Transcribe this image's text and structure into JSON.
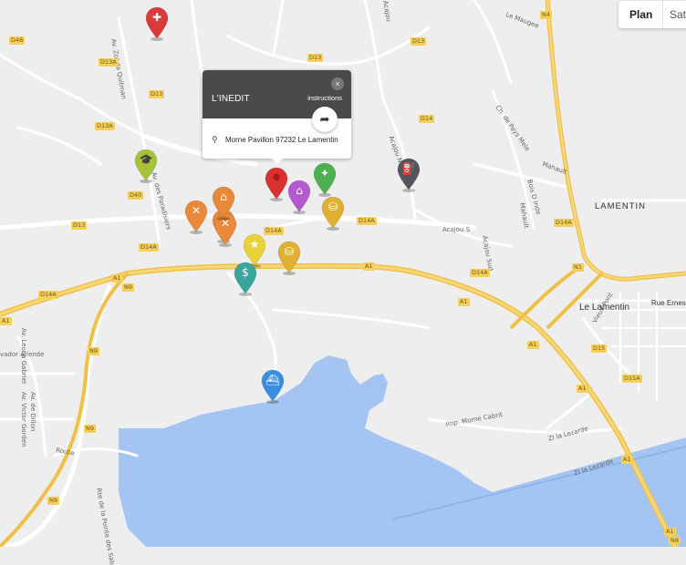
{
  "map_toggle": {
    "plan": "Plan",
    "satellite": "Sat"
  },
  "popup": {
    "title": "L'INEDIT",
    "instructions": "instructions",
    "close": "×",
    "address": "Morne Pavillon 97232 Le Lamentin",
    "directions_glyph": "➦",
    "location_glyph": "⚲"
  },
  "places": {
    "lamentin_region": "LAMENTIN",
    "le_lamentin": "Le Lamentin",
    "rue_ernest": "Rue Ernest"
  },
  "shields": {
    "d48": "D48",
    "d13_a": "D13",
    "d13_b": "D13",
    "d13_c": "D13",
    "d13_d": "D13",
    "d13a_a": "D13A",
    "d13a_b": "D13A",
    "d14": "D14",
    "d40": "D40",
    "d14a_a": "D14A",
    "d14a_b": "D14A",
    "d14a_c": "D14A",
    "d14a_d": "D14A",
    "d14a_e": "D14A",
    "d14a_f": "D14A",
    "a1_a": "A1",
    "a1_b": "A1",
    "a1_c": "A1",
    "a1_d": "A1",
    "a1_e": "A1",
    "a1_f": "A1",
    "a1_g": "A1",
    "a1_h": "A1",
    "n9_a": "N9",
    "n9_b": "N9",
    "n9_c": "N9",
    "n9_d": "N9",
    "n1": "N1",
    "n4": "N4",
    "d15": "D15",
    "d15a": "D15A",
    "d14a_g": "D14A",
    "n8": "N8"
  },
  "roads": {
    "zobda": "Av. Zobda Quitman",
    "paradisiers": "Av. des Paradisiers",
    "acajou_s": "Acajou S",
    "acajou_sud": "Acajou Sud",
    "bois_inde": "Bois D Inde",
    "mahault": "Mahault",
    "maugee": "Le Maugee",
    "pays_melee": "Ch. de Pays Mele",
    "mahault2": "Mahault",
    "vieux_pont": "Vieux Pont",
    "morne_cabrit": "Imp. Morne Cabrit",
    "lezarde_a": "ZI la Lezarde",
    "lezarde_b": "ZI la Lezarde",
    "acajou_n": "Acajou N",
    "allende": "vador Allende",
    "av_de_dillon": "Av. de Dillon",
    "gabriel": "Av. Leona Gabriel",
    "victor": "Av. Victor Gorden",
    "route": "Route",
    "pointe": "Rte de la Pointe des Sab",
    "acajou_top": "Acajou"
  },
  "colors": {
    "water": "#a4c4f2",
    "motorway": "#f2c65a",
    "highlighted_pin": "#d93030",
    "background": "#eeeeee"
  },
  "pins": [
    {
      "name": "hospital-pin",
      "icon": "hospital-icon",
      "color": "#d93a3a",
      "glyph": "✚"
    },
    {
      "name": "education-pin",
      "icon": "graduation-cap-icon",
      "color": "#a5c23a",
      "glyph": "🎓"
    },
    {
      "name": "restaurant-pin-1",
      "icon": "fork-knife-icon",
      "color": "#e98a3a",
      "glyph": "✕"
    },
    {
      "name": "restaurant-pin-2",
      "icon": "fork-knife-icon",
      "color": "#e98a3a",
      "glyph": "✕"
    },
    {
      "name": "restaurant-pin-3",
      "icon": "fork-knife-icon",
      "color": "#e98a3a",
      "glyph": "✕"
    },
    {
      "name": "bakery-pin",
      "icon": "cake-icon",
      "color": "#e98a3a",
      "glyph": "⌂"
    },
    {
      "name": "selected-place-pin",
      "icon": "selected-pin-icon",
      "color": "#d93030",
      "glyph": "●"
    },
    {
      "name": "museum-pin",
      "icon": "museum-icon",
      "color": "#b35ad1",
      "glyph": "⌂"
    },
    {
      "name": "hiking-pin",
      "icon": "hiking-icon",
      "color": "#4caf50",
      "glyph": "✦"
    },
    {
      "name": "shopping-pin-1",
      "icon": "shopping-basket-icon",
      "color": "#e0b030",
      "glyph": "⛁"
    },
    {
      "name": "gas-station-pin",
      "icon": "gas-pump-icon",
      "color": "#555560",
      "glyph": "⛽"
    },
    {
      "name": "attraction-pin",
      "icon": "star-icon",
      "color": "#ead137",
      "glyph": "★"
    },
    {
      "name": "shopping-pin-2",
      "icon": "shopping-basket-icon",
      "color": "#e0b030",
      "glyph": "⛁"
    },
    {
      "name": "bank-pin",
      "icon": "dollar-bill-icon",
      "color": "#3aa59a",
      "glyph": "$"
    },
    {
      "name": "ferry-pin",
      "icon": "ferry-icon",
      "color": "#3a8ee0",
      "glyph": "⛴"
    }
  ]
}
